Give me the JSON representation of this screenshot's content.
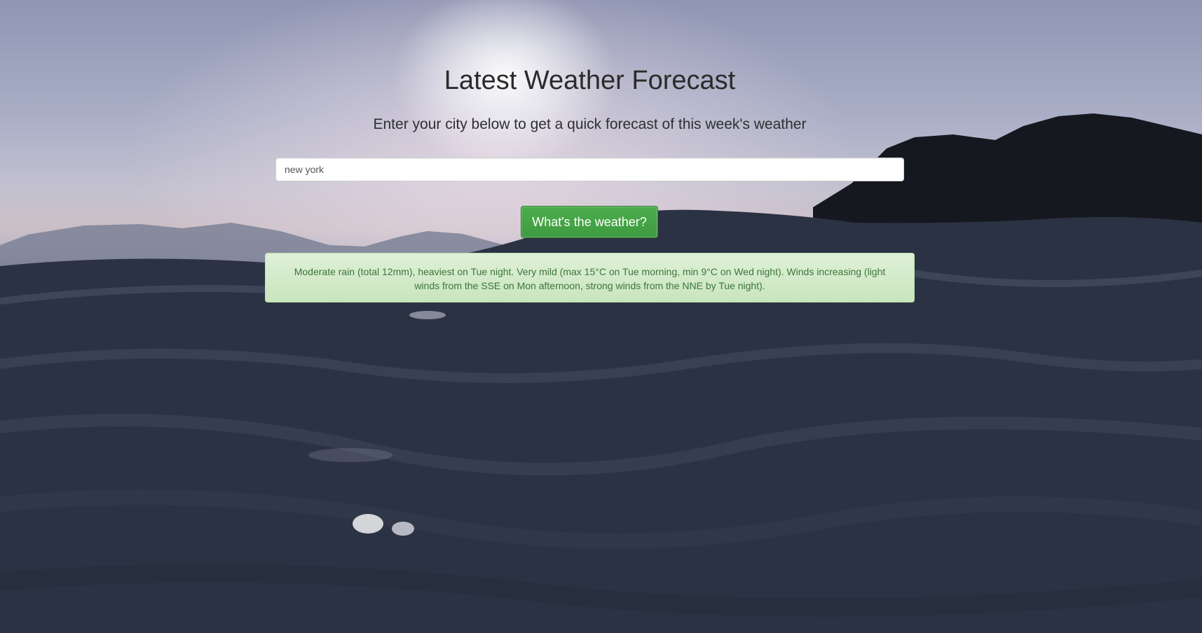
{
  "page": {
    "title": "Latest Weather Forecast",
    "subtitle": "Enter your city below to get a quick forecast of this week's weather"
  },
  "search": {
    "value": "new york",
    "placeholder": ""
  },
  "button": {
    "label": "What's the weather?"
  },
  "result": {
    "text": "Moderate rain (total 12mm), heaviest on Tue night. Very mild (max 15°C on Tue morning, min 9°C on Wed night). Winds increasing (light winds from the SSE on Mon afternoon, strong winds from the NNE by Tue night)."
  },
  "colors": {
    "button": "#449d44",
    "alert_background": "#dff0d8",
    "alert_text": "#3c763d"
  }
}
